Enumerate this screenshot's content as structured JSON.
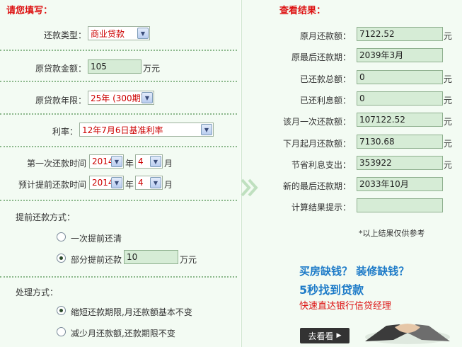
{
  "left": {
    "title": "请您填写：",
    "repay_type": {
      "label": "还款类型：",
      "value": "商业贷款"
    },
    "loan_amount": {
      "label": "原贷款金额：",
      "value": "105",
      "unit": "万元"
    },
    "loan_term": {
      "label": "原贷款年限：",
      "value": "25年 (300期)"
    },
    "rate": {
      "label": "利率：",
      "value": "12年7月6日基准利率"
    },
    "first_repay": {
      "label": "第一次还款时间",
      "year": "2014",
      "year_unit": "年",
      "month": "4",
      "month_unit": "月"
    },
    "plan_prepay": {
      "label": "预计提前还款时间",
      "year": "2014",
      "year_unit": "年",
      "month": "4",
      "month_unit": "月"
    },
    "prepay_method": {
      "title": "提前还款方式：",
      "option_full": "一次提前还清",
      "option_partial": "部分提前还款",
      "partial_value": "10",
      "partial_unit": "万元",
      "selected": "partial"
    },
    "handling": {
      "title": "处理方式：",
      "option_shorten": "缩短还款期限,月还款额基本不变",
      "option_reduce": "减少月还款额,还款期限不变",
      "selected": "shorten"
    }
  },
  "right": {
    "title": "查看结果：",
    "rows": [
      {
        "label": "原月还款额：",
        "value": "7122.52",
        "unit": "元"
      },
      {
        "label": "原最后还款期：",
        "value": "2039年3月",
        "unit": ""
      },
      {
        "label": "已还款总额：",
        "value": "0",
        "unit": "元"
      },
      {
        "label": "已还利息额：",
        "value": "0",
        "unit": "元"
      },
      {
        "label": "该月一次还款额：",
        "value": "107122.52",
        "unit": "元"
      },
      {
        "label": "下月起月还款额：",
        "value": "7130.68",
        "unit": "元"
      },
      {
        "label": "节省利息支出：",
        "value": "353922",
        "unit": "元"
      },
      {
        "label": "新的最后还款期：",
        "value": "2033年10月",
        "unit": ""
      },
      {
        "label": "计算结果提示：",
        "value": "",
        "unit": ""
      }
    ],
    "note": "*以上结果仅供参考"
  },
  "ad": {
    "line1": "买房缺钱？ 装修缺钱？",
    "line2": "5秒找到贷款",
    "line3": "快速直达银行信贷经理",
    "button": "去看看",
    "button_icon": "play-triangle-icon"
  },
  "colors": {
    "accent_red": "#dd1111",
    "field_green": "#d6ecd6",
    "ad_blue": "#1e7bc8"
  }
}
